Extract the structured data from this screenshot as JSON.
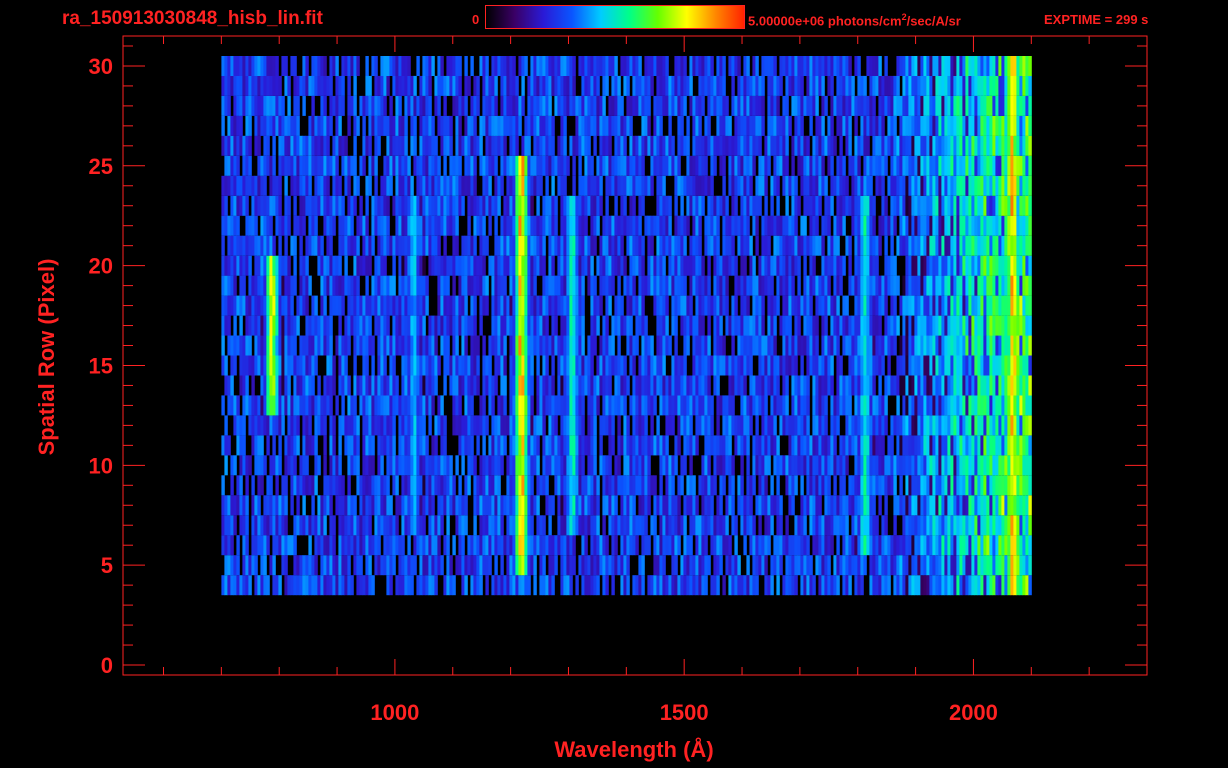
{
  "header": {
    "file_title": "ra_150913030848_hisb_lin.fit",
    "colorbar_min": "0",
    "colorbar_max_label": "5.00000e+06 photons/cm",
    "colorbar_units_sup": "2",
    "colorbar_units_rest": "/sec/A/sr",
    "exptime": "EXPTIME = 299 s"
  },
  "colors": {
    "axis": "#ff2222",
    "background": "#000000",
    "colormap": [
      "#000000",
      "#3a0066",
      "#2a1ad6",
      "#0a55ff",
      "#00ccff",
      "#00ff88",
      "#66ff00",
      "#ffff00",
      "#ff8800",
      "#ff2200"
    ]
  },
  "chart_data": {
    "type": "heatmap",
    "title": "ra_150913030848_hisb_lin.fit",
    "xlabel": "Wavelength (Å)",
    "ylabel": "Spatial Row (Pixel)",
    "xlim": [
      530,
      2300
    ],
    "ylim": [
      -0.5,
      31.5
    ],
    "xticks": [
      1000,
      1500,
      2000
    ],
    "yticks": [
      0,
      5,
      10,
      15,
      20,
      25,
      30
    ],
    "x_tick_labels": [
      "1000",
      "1500",
      "2000"
    ],
    "y_tick_labels": [
      "0",
      "5",
      "10",
      "15",
      "20",
      "25",
      "30"
    ],
    "x_minor_step": 100,
    "y_minor_step": 1,
    "color_scale": {
      "min": 0,
      "max": 5000000,
      "units": "photons/cm²/sec/A/sr",
      "scale": "linear"
    },
    "data_extent": {
      "x": [
        700,
        2095
      ],
      "rows": [
        4,
        30
      ]
    },
    "emission_features": [
      {
        "wavelength": 785,
        "rows": [
          13,
          20
        ],
        "intensity": 0.72
      },
      {
        "wavelength": 1216,
        "rows": [
          5,
          25
        ],
        "intensity": 0.82
      },
      {
        "wavelength": 1304,
        "rows": [
          7,
          23
        ],
        "intensity": 0.5
      },
      {
        "wavelength": 1030,
        "rows": [
          7,
          23
        ],
        "intensity": 0.42
      },
      {
        "wavelength": 1810,
        "rows": [
          6,
          23
        ],
        "intensity": 0.5
      },
      {
        "wavelength": 2065,
        "rows": [
          1,
          30
        ],
        "intensity": 0.8
      }
    ]
  }
}
